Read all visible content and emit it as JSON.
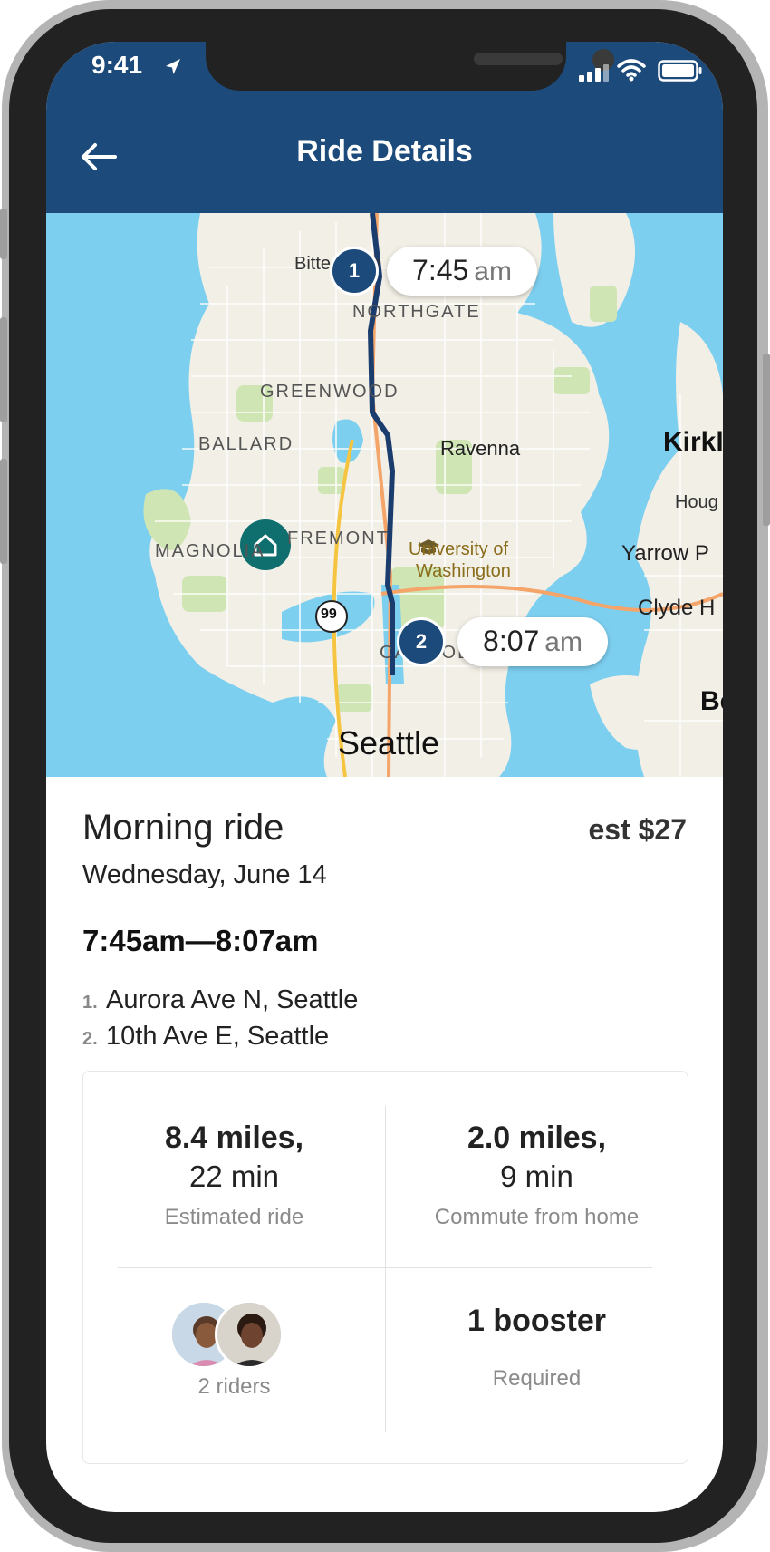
{
  "status_bar": {
    "time": "9:41"
  },
  "header": {
    "title": "Ride Details"
  },
  "map": {
    "labels": {
      "bitter_lake": "Bitter Lake",
      "northgate": "NORTHGATE",
      "greenwood": "GREENWOOD",
      "ballard": "BALLARD",
      "ravenna": "Ravenna",
      "kirkland": "Kirkl",
      "hough": "Houg",
      "fremont": "FREMONT",
      "magnolia": "MAGNOLIA",
      "university": "University of",
      "washington": "Washington",
      "yarrow": "Yarrow P",
      "clyde": "Clyde H",
      "capitol": "CAPITOL",
      "highway": "99",
      "seattle": "Seattle",
      "be": "Be"
    },
    "stops": [
      {
        "number": "1",
        "time": "7:45",
        "ampm": "am"
      },
      {
        "number": "2",
        "time": "8:07",
        "ampm": "am"
      }
    ]
  },
  "ride": {
    "title": "Morning ride",
    "price": "est $27",
    "date": "Wednesday, June 14",
    "time_range": "7:45am—8:07am",
    "stops": [
      {
        "num": "1.",
        "address": "Aurora Ave N, Seattle"
      },
      {
        "num": "2.",
        "address": "10th Ave E, Seattle"
      }
    ]
  },
  "stats": {
    "estimated": {
      "distance": "8.4 miles,",
      "duration": "22 min",
      "label": "Estimated ride"
    },
    "commute": {
      "distance": "2.0 miles,",
      "duration": "9 min",
      "label": "Commute from home"
    },
    "riders": {
      "label": "2 riders"
    },
    "booster": {
      "value": "1 booster",
      "label": "Required"
    }
  },
  "colors": {
    "header": "#1b4a7b",
    "route": "#1b3d6e",
    "home": "#0f6e6e",
    "water": "#7dcff0",
    "land": "#f2efe6"
  }
}
